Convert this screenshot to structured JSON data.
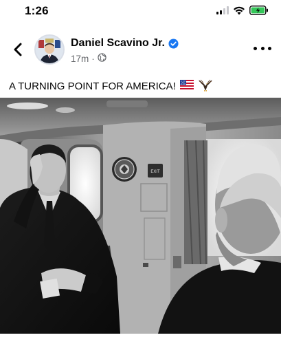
{
  "status_bar": {
    "time": "1:26"
  },
  "post": {
    "author": "Daniel Scavino Jr.",
    "time_ago": "17m",
    "separator": "·",
    "text": "A TURNING POINT FOR AMERICA!",
    "emoji_icons": [
      "us-flag-icon",
      "eagle-icon"
    ],
    "verified_color": "#1877f2"
  },
  "photo": {
    "exit_sign": "EXIT"
  }
}
